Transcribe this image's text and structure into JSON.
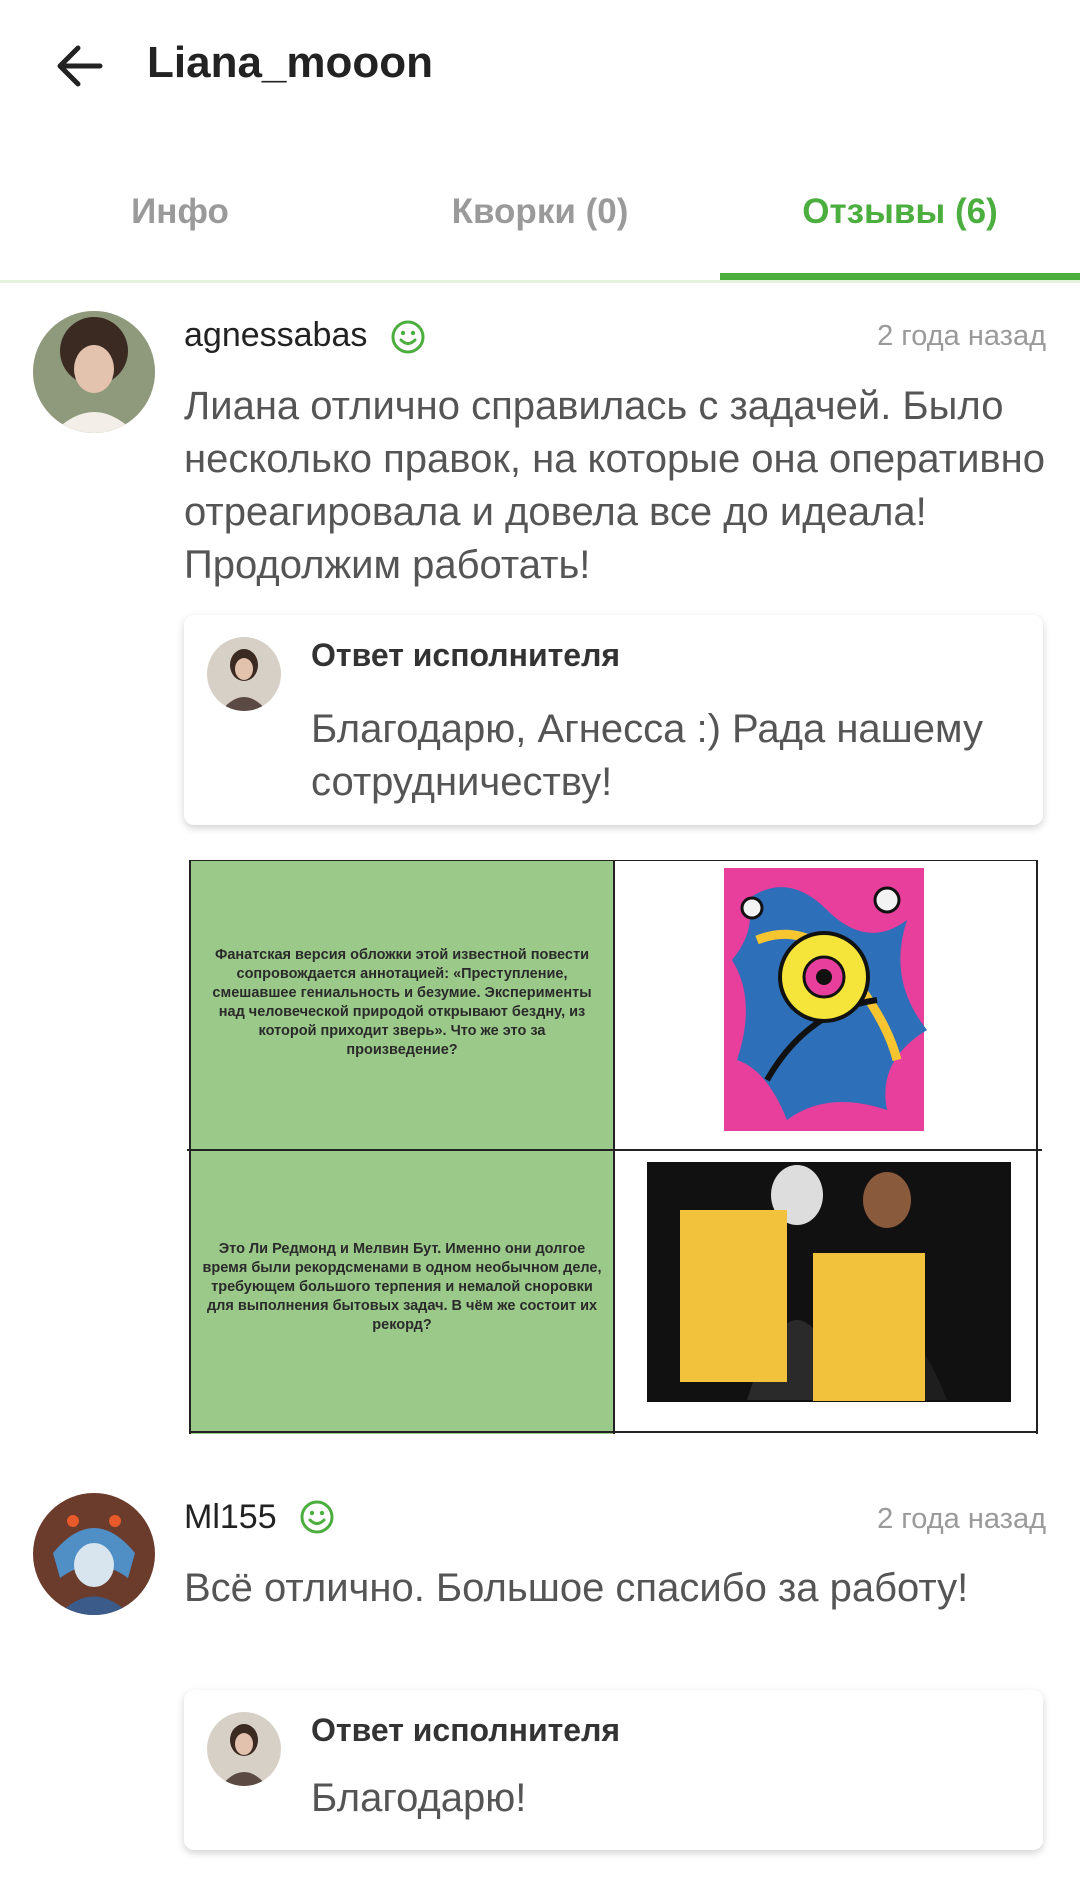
{
  "header": {
    "title": "Liana_mooon"
  },
  "tabs": [
    {
      "label": "Инфо"
    },
    {
      "label": "Кворки (0)"
    },
    {
      "label": "Отзывы (6)"
    }
  ],
  "reviews": [
    {
      "username": "agnessabas",
      "date": "2 года назад",
      "text": "Лиана отлично справилась с задачей. Было несколько правок, на которые она оперативно отреагировала и довела все до идеала! Продолжим работать!",
      "reply": {
        "title": "Ответ исполнителя",
        "text": "Благодарю, Агнесса :) Рада нашему сотрудничеству!"
      }
    },
    {
      "username": "Ml155",
      "date": "2 года назад",
      "text": "Всё отлично. Большое спасибо за работу!",
      "reply": {
        "title": "Ответ исполнителя",
        "text": "Благодарю!"
      }
    }
  ],
  "attachment": {
    "cell1_text": "Фанатская версия обложки этой известной повести сопровождается аннотацией: «Преступление, смешавшее гениальность и безумие. Эксперименты над человеческой природой открывают бездну, из которой приходит зверь». Что же это за произведение?",
    "cell3_text": "Это Ли Редмонд и Мелвин Бут. Именно они долгое время были рекордсменами в одном необычном деле, требующем большого терпения и немалой сноровки для выполнения бытовых задач. В чём же состоит их рекорд?"
  },
  "colors": {
    "accent": "#4cae3f",
    "cell_green": "#9bc98a",
    "poster_pink": "#e83e9c",
    "box_yellow": "#f2c23c"
  },
  "icons": {
    "back": "arrow-left-icon",
    "verified": "smile-icon"
  }
}
